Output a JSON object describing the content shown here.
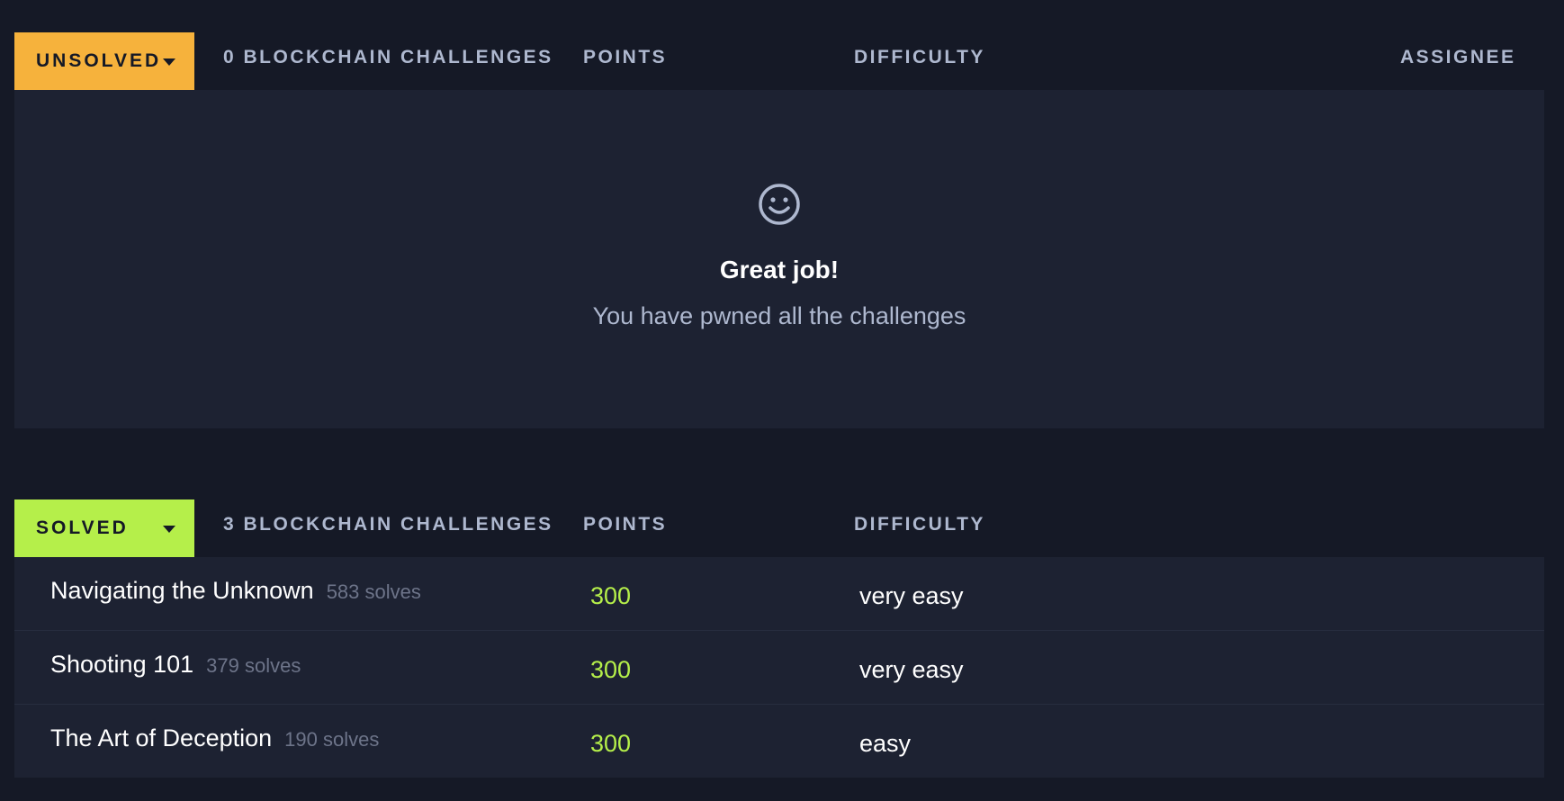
{
  "unsolved": {
    "dropdown_label": "UNSOLVED",
    "count_label": "0 BLOCKCHAIN CHALLENGES",
    "points_header": "POINTS",
    "difficulty_header": "DIFFICULTY",
    "assignee_header": "ASSIGNEE",
    "empty_icon": "smiley-icon",
    "empty_title": "Great job!",
    "empty_subtitle": "You have pwned all the challenges"
  },
  "solved": {
    "dropdown_label": "SOLVED",
    "count_label": "3 BLOCKCHAIN CHALLENGES",
    "points_header": "POINTS",
    "difficulty_header": "DIFFICULTY",
    "rows": [
      {
        "name": "Navigating the Unknown",
        "solves": "583 solves",
        "points": "300",
        "difficulty": "very easy"
      },
      {
        "name": "Shooting 101",
        "solves": "379 solves",
        "points": "300",
        "difficulty": "very easy"
      },
      {
        "name": "The Art of Deception",
        "solves": "190 solves",
        "points": "300",
        "difficulty": "easy"
      }
    ]
  },
  "colors": {
    "background": "#151926",
    "panel": "#1d2232",
    "unsolved_accent": "#f6b23c",
    "solved_accent": "#b5ef4a",
    "muted_text": "#aeb8cf"
  }
}
